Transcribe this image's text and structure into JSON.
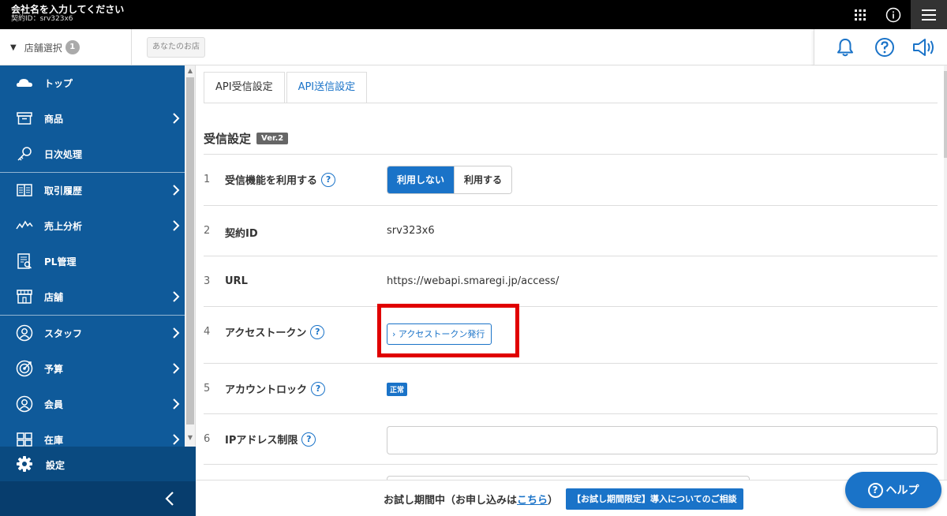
{
  "header": {
    "company": "会社名を入力してください",
    "contract": "契約ID：srv323x6"
  },
  "subbar": {
    "store_select_label": "店舗選択",
    "store_count": "1",
    "store_tag": "あなたのお店"
  },
  "sidebar": {
    "items": [
      {
        "label": "トップ",
        "icon": "cloud-icon"
      },
      {
        "label": "商品",
        "icon": "box-icon"
      },
      {
        "label": "日次処理",
        "icon": "key-icon"
      },
      {
        "label": "取引履歴",
        "icon": "book-icon"
      },
      {
        "label": "売上分析",
        "icon": "chart-line-icon"
      },
      {
        "label": "PL管理",
        "icon": "document-icon"
      },
      {
        "label": "店舗",
        "icon": "store-icon"
      },
      {
        "label": "スタッフ",
        "icon": "person-icon"
      },
      {
        "label": "予算",
        "icon": "target-icon"
      },
      {
        "label": "会員",
        "icon": "member-icon"
      },
      {
        "label": "在庫",
        "icon": "shelf-icon"
      }
    ],
    "settings_label": "設定"
  },
  "tabs": {
    "receive": "API受信設定",
    "send": "API送信設定"
  },
  "section": {
    "title": "受信設定",
    "version": "Ver.2"
  },
  "rows": [
    {
      "num": "1",
      "label": "受信機能を利用する",
      "toggle_on": "利用しない",
      "toggle_off": "利用する"
    },
    {
      "num": "2",
      "label": "契約ID",
      "value": "srv323x6"
    },
    {
      "num": "3",
      "label": "URL",
      "value": "https://webapi.smaregi.jp/access/"
    },
    {
      "num": "4",
      "label": "アクセストークン",
      "button": "アクセストークン発行"
    },
    {
      "num": "5",
      "label": "アカウントロック",
      "badge": "正常"
    },
    {
      "num": "6",
      "label": "IPアドレス制限"
    }
  ],
  "help_mark": "?",
  "trial": {
    "text_before": "お試し期間中（お申し込みは",
    "link": "こちら",
    "text_after": "）",
    "consult_button": "【お試し期間限定】導入についてのご相談"
  },
  "help_button": "ヘルプ",
  "colors": {
    "accent": "#1a73c8",
    "sidebar": "#0f5a9a",
    "highlight": "#e00000"
  }
}
